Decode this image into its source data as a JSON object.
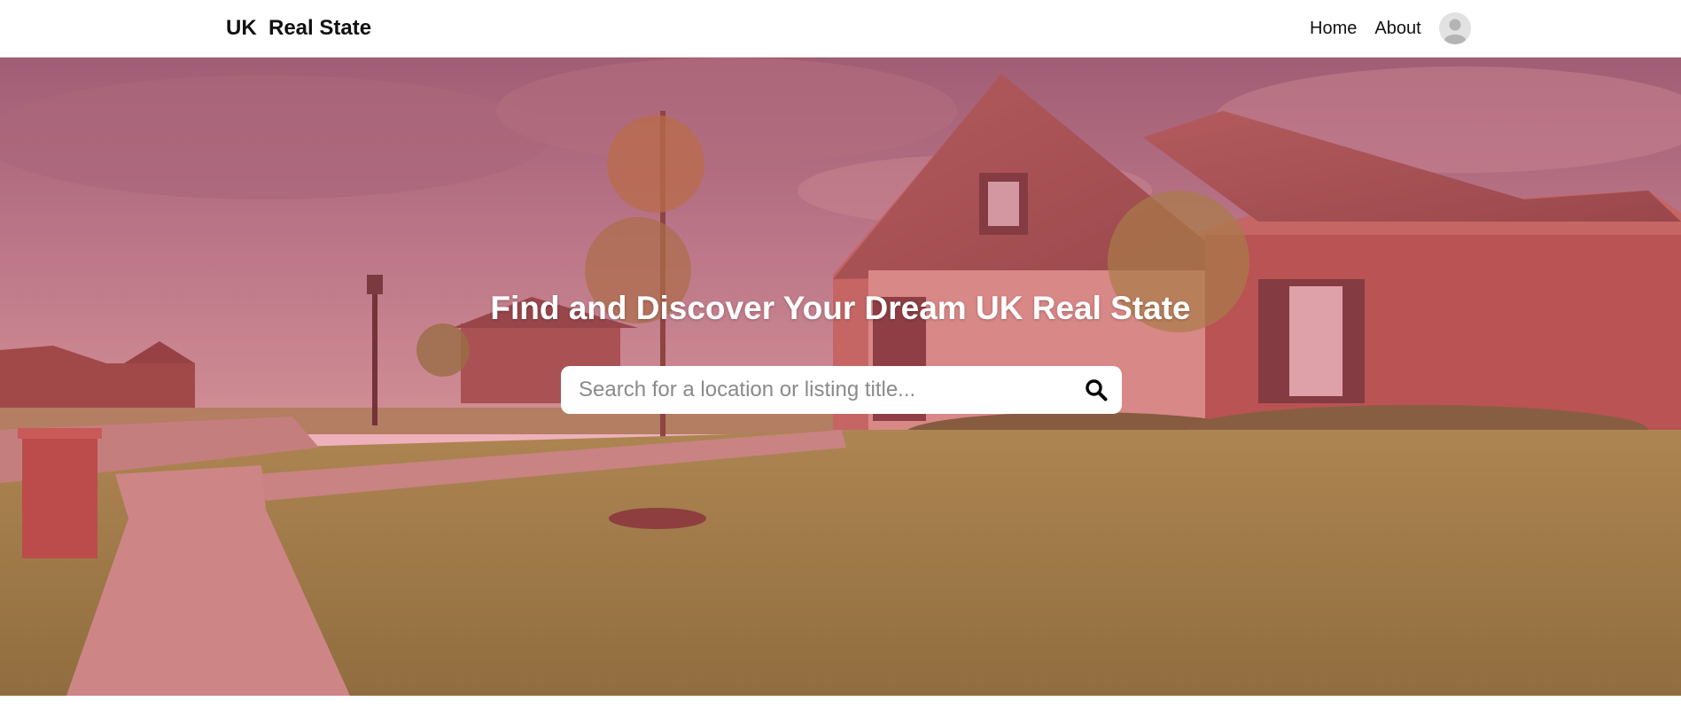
{
  "navbar": {
    "brand": "UK  Real State",
    "links": [
      {
        "label": "Home"
      },
      {
        "label": "About"
      }
    ],
    "avatar_icon": "user-avatar-icon"
  },
  "hero": {
    "title_before": "Find and Discover Your Dream ",
    "title_bold": "UK",
    "title_after": " Real State",
    "overlay_color": "#d6455c",
    "search": {
      "placeholder": "Search for a location or listing title...",
      "value": "",
      "button_icon": "search-icon"
    }
  }
}
